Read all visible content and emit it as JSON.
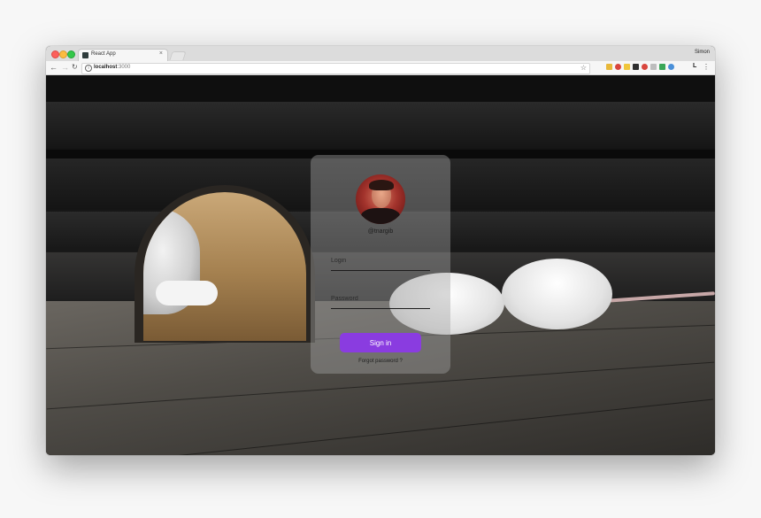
{
  "browser": {
    "tab_title": "React App",
    "tab_close": "×",
    "profile_name": "Simon",
    "url_host": "localhost",
    "url_port": ":3000",
    "icons": [
      "back-icon",
      "forward-icon",
      "reload-icon",
      "info-icon",
      "star-icon",
      "menu-icon"
    ],
    "ext_colors": [
      "#e8b83a",
      "#d8453d",
      "#f0c63c",
      "#2f2f2f",
      "#d8453d",
      "#bdbdbd",
      "#3aa757",
      "#4a90d9"
    ],
    "ext_letter": "L"
  },
  "login": {
    "username": "@tnargib",
    "login_placeholder": "Login",
    "password_placeholder": "Password",
    "signin_label": "Sign in",
    "forgot_label": "Forgot password ?",
    "accent_color": "#8a3ce0"
  }
}
